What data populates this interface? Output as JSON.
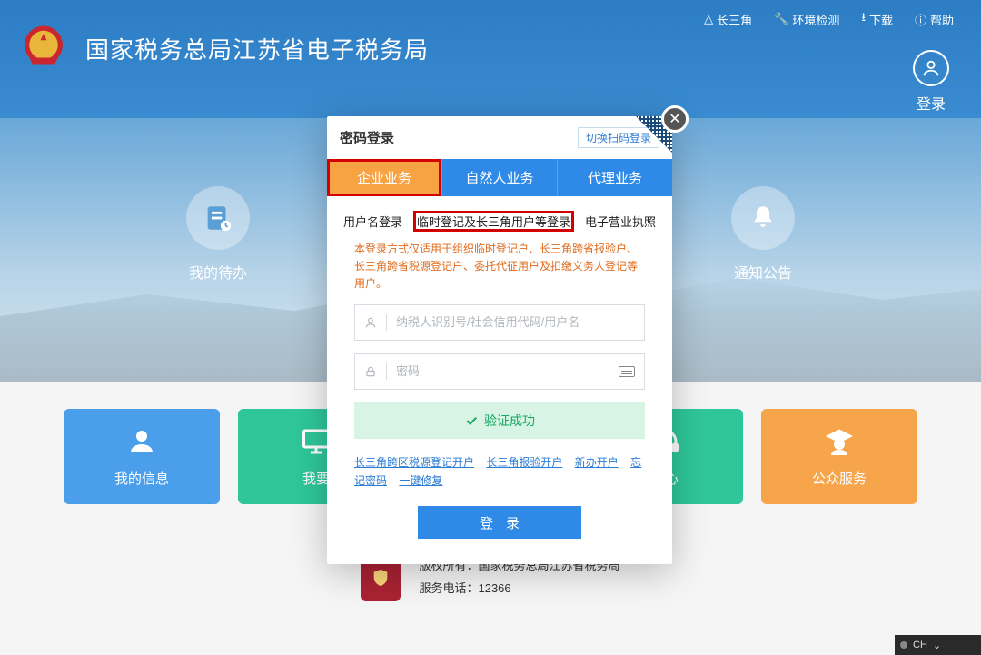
{
  "topLinks": {
    "csj": "长三角",
    "env": "环境检测",
    "download": "下载",
    "help": "帮助"
  },
  "loginBtn": "登录",
  "brandTitle": "国家税务总局江苏省电子税务局",
  "sideLeft": "我的待办",
  "sideRight": "通知公告",
  "tiles": {
    "t1": "我的信息",
    "t2": "我要",
    "t3": "",
    "t4": "中心",
    "t5": "公众服务"
  },
  "footer": {
    "line1": "版权所有：国家税务总局江苏省税务局",
    "line2": "服务电话：12366"
  },
  "modal": {
    "title": "密码登录",
    "switch": "切换扫码登录",
    "bizTabs": {
      "t1": "企业业务",
      "t2": "自然人业务",
      "t3": "代理业务"
    },
    "subTabs": {
      "s1": "用户名登录",
      "s2": "临时登记及长三角用户等登录",
      "s3": "电子营业执照"
    },
    "hint": "本登录方式仅适用于组织临时登记户、长三角跨省报验户、长三角跨省税源登记户、委托代征用户及扣缴义务人登记等用户。",
    "userPh": "纳税人识别号/社会信用代码/用户名",
    "pwdPh": "密码",
    "verify": "验证成功",
    "links": {
      "l1": "长三角跨区税源登记开户",
      "l2": "长三角报验开户",
      "l3": "新办开户",
      "l4": "忘记密码",
      "l5": "一键修复"
    },
    "submit": "登录"
  },
  "ime": "CH"
}
